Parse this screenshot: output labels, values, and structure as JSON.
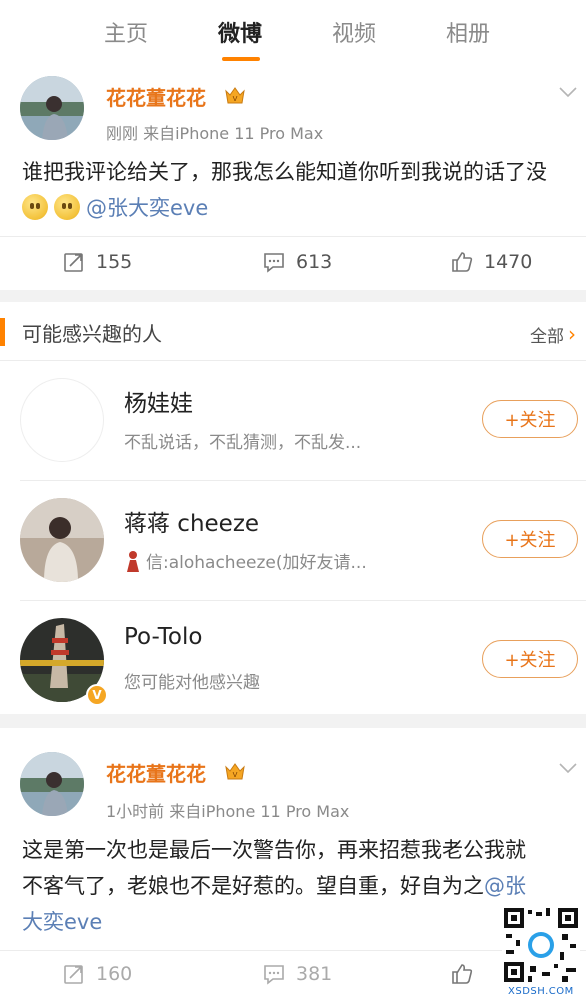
{
  "tabs": [
    {
      "label": "主页",
      "active": false
    },
    {
      "label": "微博",
      "active": true
    },
    {
      "label": "视频",
      "active": false
    },
    {
      "label": "相册",
      "active": false
    }
  ],
  "accent_color": "#ff8200",
  "posts": [
    {
      "author": "花花董花花",
      "time": "刚刚",
      "source": "来自iPhone 11 Pro Max",
      "text": "谁把我评论给关了，那我怎么能知道你听到我说的话了没",
      "emojis": 2,
      "mention": "@张大奕eve",
      "reposts": "155",
      "comments": "613",
      "likes": "1470"
    },
    {
      "author": "花花董花花",
      "time": "1小时前",
      "source": "来自iPhone 11 Pro Max",
      "text": "这是第一次也是最后一次警告你，再来招惹我老公我就不客气了，老娘也不是好惹的。望自重，好自为之",
      "mention": "@张大奕eve",
      "reposts": "160",
      "comments": "381"
    }
  ],
  "recommendations": {
    "title": "可能感兴趣的人",
    "all_label": "全部",
    "people": [
      {
        "name": "杨娃娃",
        "desc": "不乱说话，不乱猜测，不乱发...",
        "follow_label": "+关注"
      },
      {
        "name": "蒋蒋 cheeze",
        "desc": "信:alohacheeze(加好友请...",
        "follow_label": "+关注"
      },
      {
        "name": "Po-Tolo",
        "desc": "您可能对他感兴趣",
        "follow_label": "+关注"
      }
    ]
  },
  "watermark": "XSDSH.COM"
}
